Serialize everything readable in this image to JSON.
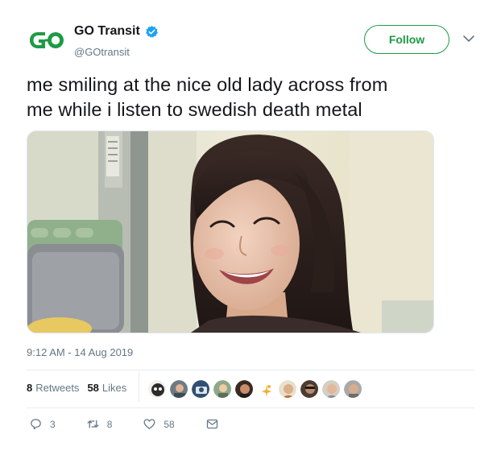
{
  "account": {
    "display_name": "GO Transit",
    "handle": "@GOtransit",
    "verified": true,
    "avatar_icon": "go-transit-logo-icon",
    "brand_color": "#1d9b44"
  },
  "header": {
    "follow_label": "Follow",
    "more_icon": "chevron-down-icon"
  },
  "tweet": {
    "text_line1": "me smiling at the nice old lady across from",
    "text_line2": "me while i listen to swedish death metal",
    "timestamp": "9:12 AM - 14 Aug 2019"
  },
  "stats": {
    "retweets_count": "8",
    "retweets_label": "Retweets",
    "likes_count": "58",
    "likes_label": "Likes",
    "liker_avatar_count": 10
  },
  "actions": {
    "reply_icon": "reply-icon",
    "reply_count": "3",
    "retweet_icon": "retweet-icon",
    "retweet_count": "8",
    "like_icon": "heart-icon",
    "like_count": "58",
    "dm_icon": "envelope-icon"
  }
}
